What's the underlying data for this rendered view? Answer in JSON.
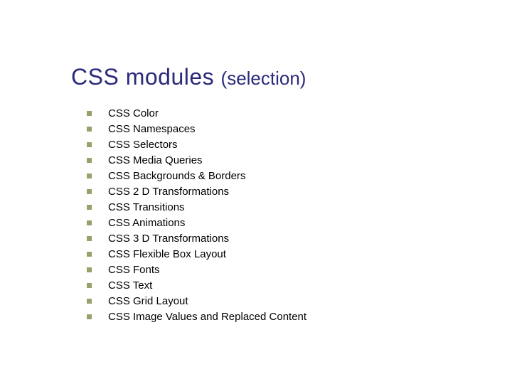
{
  "title": {
    "main": "CSS modules ",
    "sub": "(selection)"
  },
  "items": [
    "CSS Color",
    "CSS Namespaces",
    "CSS Selectors",
    "CSS Media Queries",
    "CSS Backgrounds & Borders",
    "CSS 2 D Transformations",
    "CSS Transitions",
    "CSS Animations",
    "CSS 3 D Transformations",
    "CSS Flexible Box Layout",
    "CSS Fonts",
    "CSS Text",
    "CSS Grid Layout",
    "CSS Image Values and Replaced Content"
  ]
}
